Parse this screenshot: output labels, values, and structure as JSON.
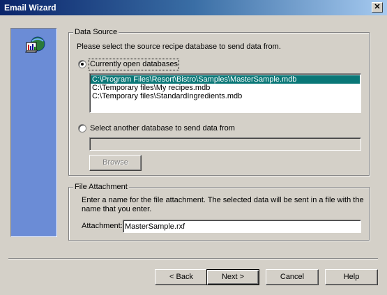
{
  "window": {
    "title": "Email Wizard",
    "close_glyph": "✕"
  },
  "sidepanel": {
    "icon": "database-export-icon",
    "color": "#6b8cd6"
  },
  "data_source": {
    "legend": "Data Source",
    "instruction": "Please select the source recipe database to send data from.",
    "open_db_option": {
      "label": "Currently open databases",
      "selected": true
    },
    "databases": [
      {
        "path": "C:\\Program Files\\Resort\\Bistro\\Samples\\MasterSample.mdb",
        "selected": true
      },
      {
        "path": "C:\\Temporary files\\My recipes.mdb",
        "selected": false
      },
      {
        "path": "C:\\Temporary files\\StandardIngredients.mdb",
        "selected": false
      }
    ],
    "other_db_option": {
      "label": "Select another database to send data from",
      "selected": false,
      "value": ""
    },
    "browse_label": "Browse"
  },
  "file_attachment": {
    "legend": "File Attachment",
    "instruction_line1": "Enter a name for the file attachment.  The selected data will be sent in a file with the",
    "instruction_line2": "name that you enter.",
    "attachment_label": "Attachment:",
    "attachment_value": "MasterSample.rxf"
  },
  "buttons": {
    "back_label": "< Back",
    "next_label": "Next >",
    "cancel_label": "Cancel",
    "help_label": "Help"
  },
  "colors": {
    "title_bar": "#0a246a",
    "selection": "#0a7777",
    "face": "#d4d0c8"
  }
}
